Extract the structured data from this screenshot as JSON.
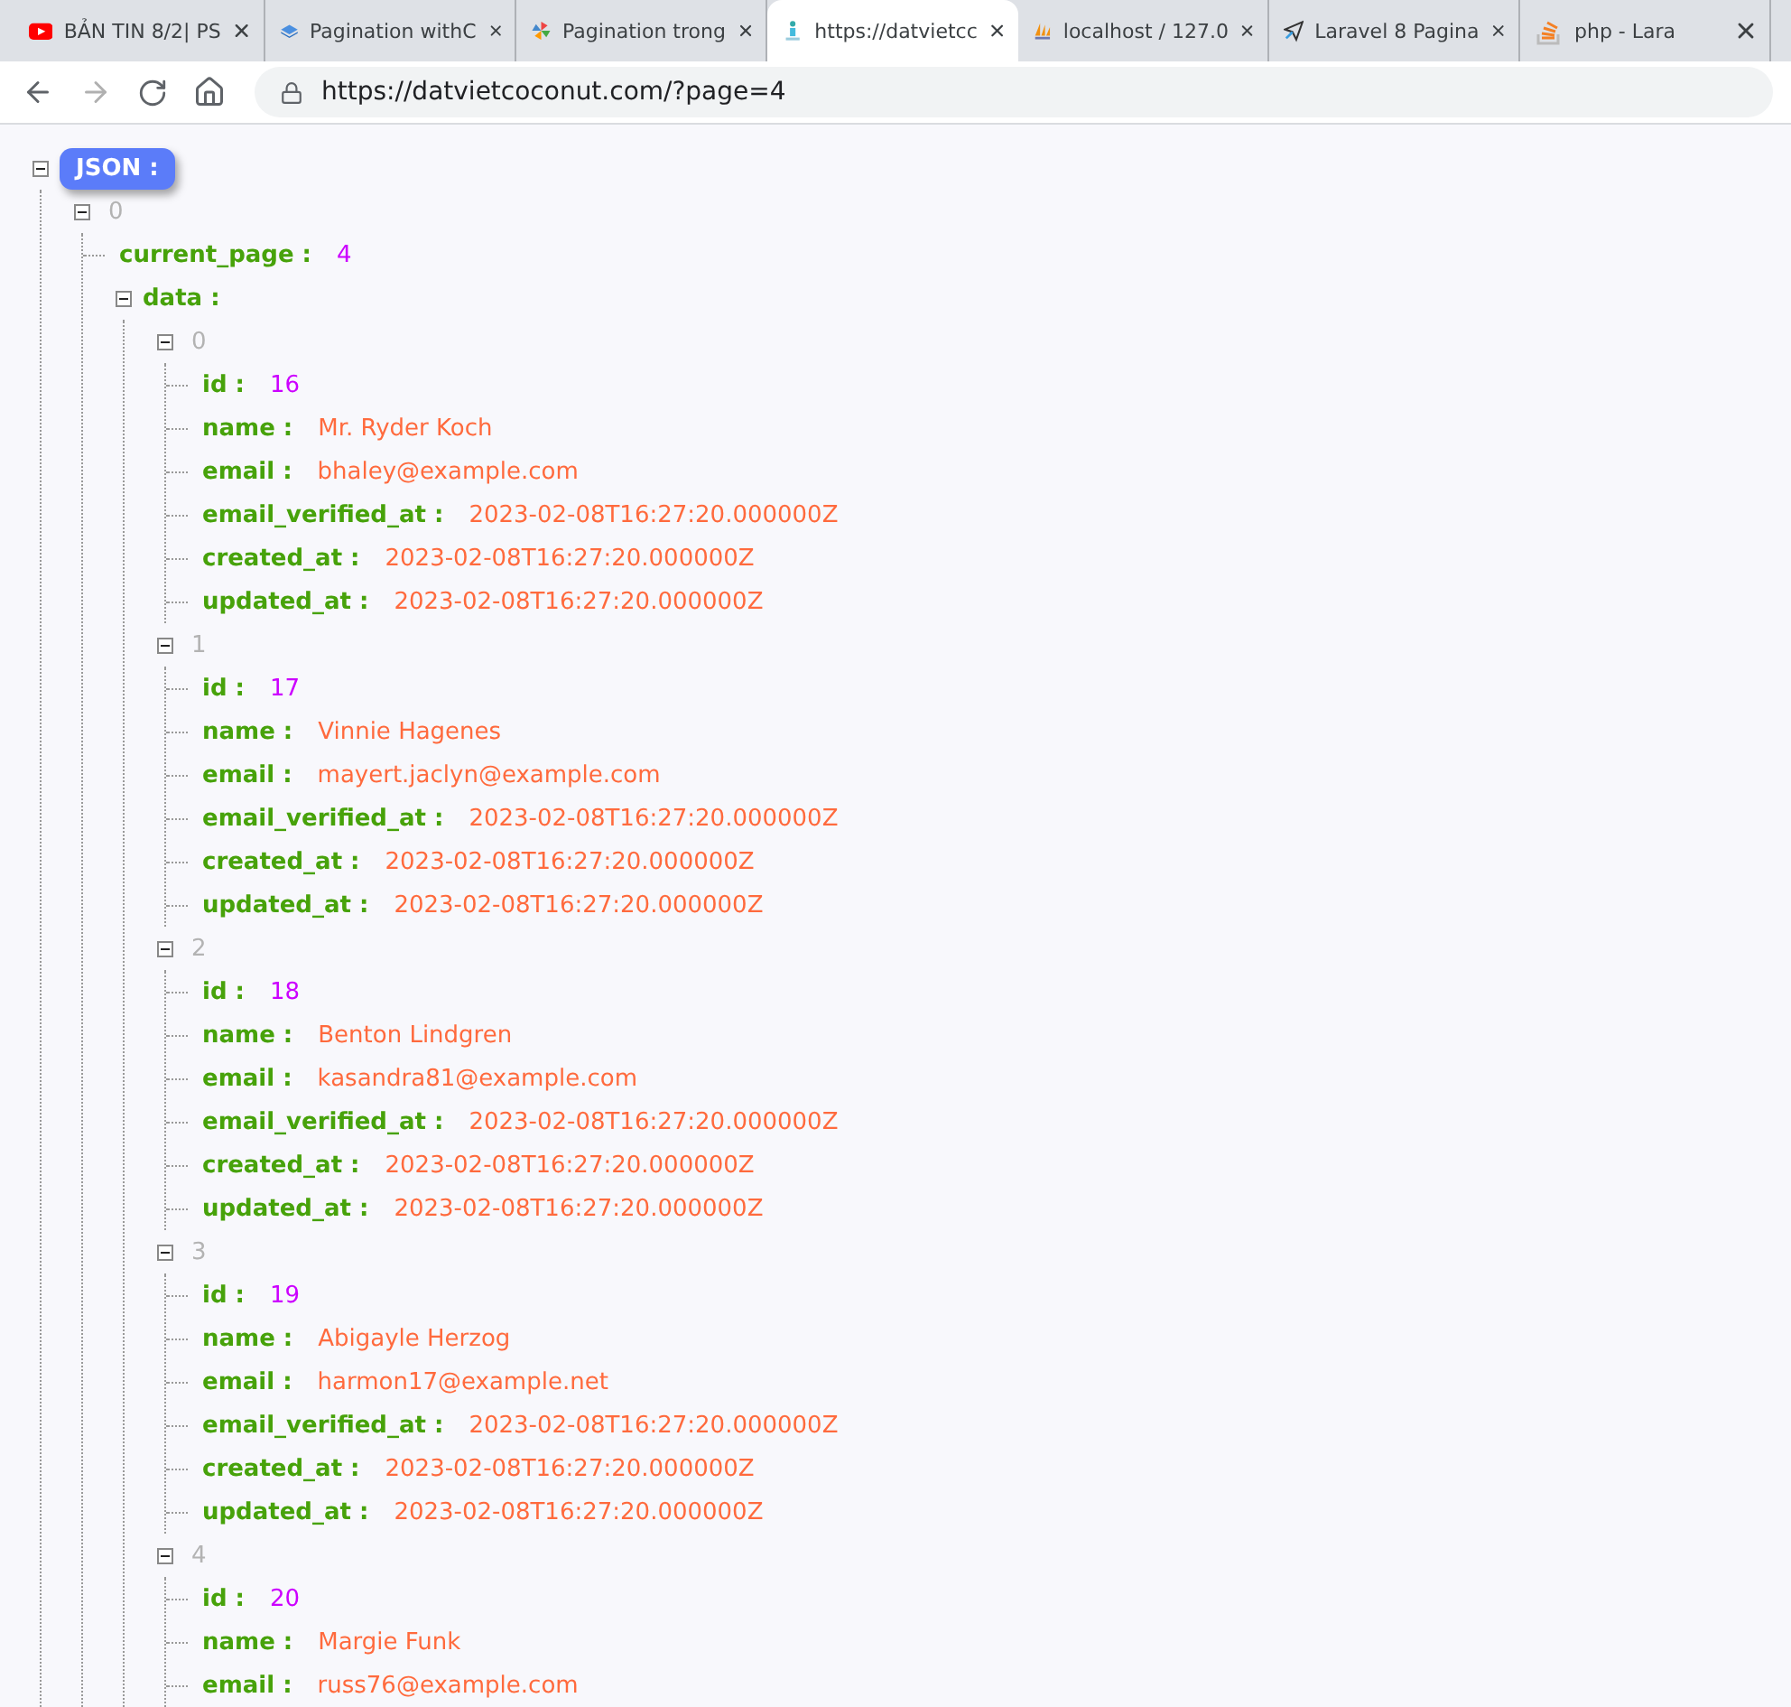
{
  "tabs": [
    {
      "title": "BẢN TIN 8/2| PS",
      "selected": false
    },
    {
      "title": "Pagination withC",
      "selected": false
    },
    {
      "title": "Pagination trong",
      "selected": false
    },
    {
      "title": "https://datvietcc",
      "selected": true
    },
    {
      "title": "localhost / 127.0",
      "selected": false
    },
    {
      "title": "Laravel 8 Pagina",
      "selected": false
    },
    {
      "title": "php - Lara",
      "selected": false
    }
  ],
  "address_bar": {
    "url": "https://datvietcoconut.com/?page=4"
  },
  "tree": {
    "label": "JSON :",
    "expanded": true,
    "children": [
      {
        "key": "0",
        "kind": "index",
        "expanded": true,
        "children": [
          {
            "key": "current_page :",
            "kind": "number",
            "value": "4"
          },
          {
            "key": "data :",
            "kind": "object",
            "expanded": true,
            "children": [
              {
                "key": "0",
                "kind": "index",
                "expanded": true,
                "children": [
                  {
                    "key": "id :",
                    "kind": "number",
                    "value": "16"
                  },
                  {
                    "key": "name :",
                    "kind": "string",
                    "value": "Mr. Ryder Koch"
                  },
                  {
                    "key": "email :",
                    "kind": "string",
                    "value": "bhaley@example.com"
                  },
                  {
                    "key": "email_verified_at :",
                    "kind": "string",
                    "value": "2023-02-08T16:27:20.000000Z"
                  },
                  {
                    "key": "created_at :",
                    "kind": "string",
                    "value": "2023-02-08T16:27:20.000000Z"
                  },
                  {
                    "key": "updated_at :",
                    "kind": "string",
                    "value": "2023-02-08T16:27:20.000000Z"
                  }
                ]
              },
              {
                "key": "1",
                "kind": "index",
                "expanded": true,
                "children": [
                  {
                    "key": "id :",
                    "kind": "number",
                    "value": "17"
                  },
                  {
                    "key": "name :",
                    "kind": "string",
                    "value": "Vinnie Hagenes"
                  },
                  {
                    "key": "email :",
                    "kind": "string",
                    "value": "mayert.jaclyn@example.com"
                  },
                  {
                    "key": "email_verified_at :",
                    "kind": "string",
                    "value": "2023-02-08T16:27:20.000000Z"
                  },
                  {
                    "key": "created_at :",
                    "kind": "string",
                    "value": "2023-02-08T16:27:20.000000Z"
                  },
                  {
                    "key": "updated_at :",
                    "kind": "string",
                    "value": "2023-02-08T16:27:20.000000Z"
                  }
                ]
              },
              {
                "key": "2",
                "kind": "index",
                "expanded": true,
                "children": [
                  {
                    "key": "id :",
                    "kind": "number",
                    "value": "18"
                  },
                  {
                    "key": "name :",
                    "kind": "string",
                    "value": "Benton Lindgren"
                  },
                  {
                    "key": "email :",
                    "kind": "string",
                    "value": "kasandra81@example.com"
                  },
                  {
                    "key": "email_verified_at :",
                    "kind": "string",
                    "value": "2023-02-08T16:27:20.000000Z"
                  },
                  {
                    "key": "created_at :",
                    "kind": "string",
                    "value": "2023-02-08T16:27:20.000000Z"
                  },
                  {
                    "key": "updated_at :",
                    "kind": "string",
                    "value": "2023-02-08T16:27:20.000000Z"
                  }
                ]
              },
              {
                "key": "3",
                "kind": "index",
                "expanded": true,
                "children": [
                  {
                    "key": "id :",
                    "kind": "number",
                    "value": "19"
                  },
                  {
                    "key": "name :",
                    "kind": "string",
                    "value": "Abigayle Herzog"
                  },
                  {
                    "key": "email :",
                    "kind": "string",
                    "value": "harmon17@example.net"
                  },
                  {
                    "key": "email_verified_at :",
                    "kind": "string",
                    "value": "2023-02-08T16:27:20.000000Z"
                  },
                  {
                    "key": "created_at :",
                    "kind": "string",
                    "value": "2023-02-08T16:27:20.000000Z"
                  },
                  {
                    "key": "updated_at :",
                    "kind": "string",
                    "value": "2023-02-08T16:27:20.000000Z"
                  }
                ]
              },
              {
                "key": "4",
                "kind": "index",
                "expanded": true,
                "children": [
                  {
                    "key": "id :",
                    "kind": "number",
                    "value": "20"
                  },
                  {
                    "key": "name :",
                    "kind": "string",
                    "value": "Margie Funk"
                  },
                  {
                    "key": "email :",
                    "kind": "string",
                    "value": "russ76@example.com"
                  }
                ]
              }
            ]
          }
        ]
      }
    ]
  }
}
